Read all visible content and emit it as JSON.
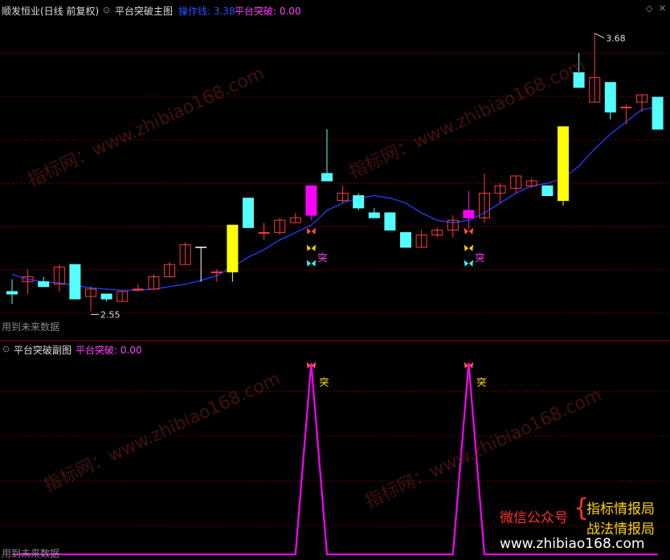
{
  "main_header": {
    "stock": "顺发恒业(日线 前复权)",
    "indicator": "平台突破主图",
    "line_label": "操作线: 3.38",
    "signal_label": "平台突破: 0.00"
  },
  "sub_header": {
    "indicator": "平台突破副图",
    "signal_label": "平台突破: 0.00"
  },
  "future_note": "用到未来数据",
  "future_note_sub": "用到未来数据",
  "signal_char": "突",
  "high_label": "3.68",
  "low_label": "2.55",
  "watermarks": [
    "指标网：www.zhibiao168.com",
    "指标网：www.zhibiao168.com",
    "指标网：www.zhibiao168.com",
    "指标网：www.zhibiao168.com"
  ],
  "brand": {
    "wechat": "微信公众号",
    "name1": "指标情报局",
    "name2": "战法情报局",
    "url": "www.zhibiao168.com"
  },
  "colors": {
    "up": "#ff3b3b",
    "down": "#54ffff",
    "highlight_up": "#ff00ff",
    "highlight_big": "#ffff00",
    "ma": "#2040ff",
    "signal_line": "#ff00ff"
  },
  "chart_data": [
    {
      "type": "candlestick",
      "name": "平台突破主图",
      "ylim": [
        2.45,
        3.75
      ],
      "candles": [
        {
          "o": 2.63,
          "h": 2.68,
          "l": 2.58,
          "c": 2.62
        },
        {
          "o": 2.67,
          "h": 2.72,
          "l": 2.62,
          "c": 2.69
        },
        {
          "o": 2.67,
          "h": 2.69,
          "l": 2.65,
          "c": 2.65
        },
        {
          "o": 2.66,
          "h": 2.74,
          "l": 2.63,
          "c": 2.73
        },
        {
          "o": 2.74,
          "h": 2.74,
          "l": 2.6,
          "c": 2.6
        },
        {
          "o": 2.61,
          "h": 2.65,
          "l": 2.55,
          "c": 2.64
        },
        {
          "o": 2.62,
          "h": 2.62,
          "l": 2.59,
          "c": 2.6
        },
        {
          "o": 2.59,
          "h": 2.63,
          "l": 2.59,
          "c": 2.63
        },
        {
          "o": 2.64,
          "h": 2.66,
          "l": 2.63,
          "c": 2.64
        },
        {
          "o": 2.64,
          "h": 2.7,
          "l": 2.64,
          "c": 2.69
        },
        {
          "o": 2.69,
          "h": 2.75,
          "l": 2.69,
          "c": 2.74
        },
        {
          "o": 2.74,
          "h": 2.83,
          "l": 2.74,
          "c": 2.82
        },
        {
          "o": 2.81,
          "h": 2.81,
          "l": 2.67,
          "c": 2.67,
          "cross": true
        },
        {
          "o": 2.71,
          "h": 2.72,
          "l": 2.67,
          "c": 2.71
        },
        {
          "o": 2.71,
          "h": 2.9,
          "l": 2.67,
          "c": 2.9,
          "big": true
        },
        {
          "o": 3.01,
          "h": 3.01,
          "l": 2.89,
          "c": 2.89
        },
        {
          "o": 2.87,
          "h": 2.91,
          "l": 2.84,
          "c": 2.87
        },
        {
          "o": 2.87,
          "h": 2.93,
          "l": 2.86,
          "c": 2.92
        },
        {
          "o": 2.91,
          "h": 2.95,
          "l": 2.91,
          "c": 2.93
        },
        {
          "o": 2.94,
          "h": 3.06,
          "l": 2.92,
          "c": 3.06,
          "mag": true
        },
        {
          "o": 3.11,
          "h": 3.29,
          "l": 3.08,
          "c": 3.08
        },
        {
          "o": 3.0,
          "h": 3.06,
          "l": 2.99,
          "c": 3.03
        },
        {
          "o": 3.02,
          "h": 3.03,
          "l": 2.96,
          "c": 2.97
        },
        {
          "o": 2.95,
          "h": 2.97,
          "l": 2.93,
          "c": 2.93
        },
        {
          "o": 2.95,
          "h": 2.95,
          "l": 2.88,
          "c": 2.88
        },
        {
          "o": 2.87,
          "h": 2.87,
          "l": 2.81,
          "c": 2.81
        },
        {
          "o": 2.81,
          "h": 2.88,
          "l": 2.81,
          "c": 2.86
        },
        {
          "o": 2.86,
          "h": 2.89,
          "l": 2.85,
          "c": 2.88
        },
        {
          "o": 2.88,
          "h": 2.94,
          "l": 2.85,
          "c": 2.92
        },
        {
          "o": 2.96,
          "h": 3.04,
          "l": 2.88,
          "c": 2.93,
          "mag": true
        },
        {
          "o": 2.93,
          "h": 3.11,
          "l": 2.91,
          "c": 3.03
        },
        {
          "o": 3.03,
          "h": 3.07,
          "l": 2.99,
          "c": 3.06
        },
        {
          "o": 3.05,
          "h": 3.1,
          "l": 3.03,
          "c": 3.1
        },
        {
          "o": 3.06,
          "h": 3.09,
          "l": 3.05,
          "c": 3.08
        },
        {
          "o": 3.06,
          "h": 3.06,
          "l": 3.02,
          "c": 3.02
        },
        {
          "o": 3.0,
          "h": 3.3,
          "l": 2.98,
          "c": 3.3,
          "big": true
        },
        {
          "o": 3.52,
          "h": 3.6,
          "l": 3.46,
          "c": 3.46
        },
        {
          "o": 3.4,
          "h": 3.68,
          "l": 3.4,
          "c": 3.5
        },
        {
          "o": 3.48,
          "h": 3.48,
          "l": 3.33,
          "c": 3.36
        },
        {
          "o": 3.38,
          "h": 3.39,
          "l": 3.31,
          "c": 3.38
        },
        {
          "o": 3.4,
          "h": 3.43,
          "l": 3.36,
          "c": 3.43
        },
        {
          "o": 3.42,
          "h": 3.42,
          "l": 3.29,
          "c": 3.29
        }
      ],
      "ma": [
        2.7,
        2.68,
        2.67,
        2.665,
        2.655,
        2.645,
        2.64,
        2.635,
        2.635,
        2.64,
        2.65,
        2.66,
        2.675,
        2.695,
        2.73,
        2.77,
        2.8,
        2.84,
        2.87,
        2.9,
        2.96,
        2.99,
        3.01,
        3.02,
        3.01,
        2.99,
        2.95,
        2.92,
        2.91,
        2.92,
        2.95,
        2.99,
        3.03,
        3.06,
        3.07,
        3.09,
        3.14,
        3.21,
        3.27,
        3.32,
        3.37,
        3.38
      ],
      "signals": [
        19,
        29
      ]
    },
    {
      "type": "line",
      "name": "平台突破副图",
      "ylim": [
        0,
        1
      ],
      "values": [
        0,
        0,
        0,
        0,
        0,
        0,
        0,
        0,
        0,
        0,
        0,
        0,
        0,
        0,
        0,
        0,
        0,
        0,
        0,
        1,
        0,
        0,
        0,
        0,
        0,
        0,
        0,
        0,
        0,
        1,
        0,
        0,
        0,
        0,
        0,
        0,
        0,
        0,
        0,
        0,
        0,
        0
      ]
    }
  ]
}
